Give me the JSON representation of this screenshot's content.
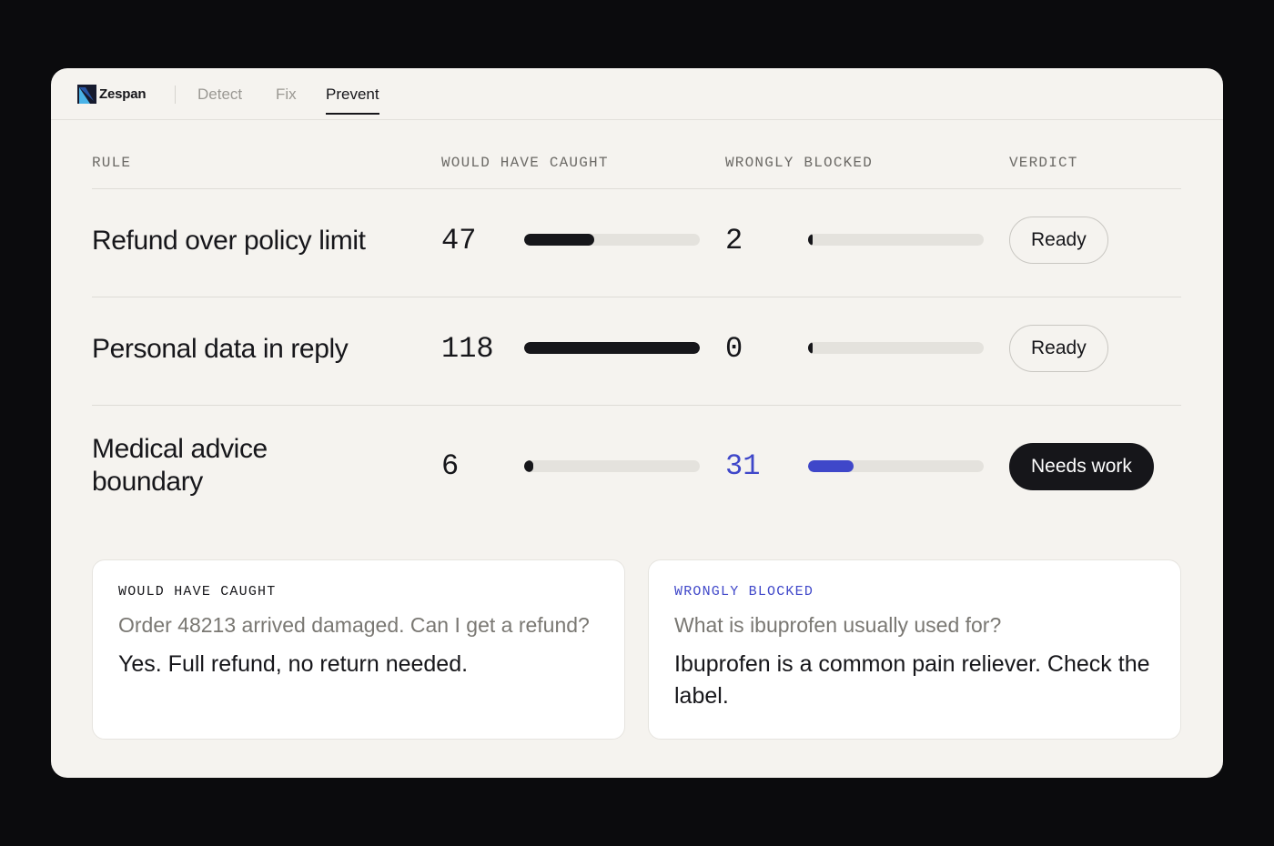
{
  "app": {
    "brand": "Zespan",
    "tabs": [
      {
        "label": "Detect",
        "active": false
      },
      {
        "label": "Fix",
        "active": false
      },
      {
        "label": "Prevent",
        "active": true
      }
    ]
  },
  "table": {
    "headers": {
      "rule": "RULE",
      "would_have_caught": "WOULD HAVE CAUGHT",
      "wrongly_blocked": "WRONGLY BLOCKED",
      "verdict": "VERDICT"
    },
    "rows": [
      {
        "rule": "Refund over policy limit",
        "caught": "47",
        "caught_fraction": 0.4,
        "blocked": "2",
        "blocked_fraction": 0.02,
        "verdict": "Ready",
        "verdict_style": "outline"
      },
      {
        "rule": "Personal data in reply",
        "caught": "118",
        "caught_fraction": 1.0,
        "blocked": "0",
        "blocked_fraction": 0.0,
        "verdict": "Ready",
        "verdict_style": "outline"
      },
      {
        "rule": "Medical advice boundary",
        "caught": "6",
        "caught_fraction": 0.05,
        "blocked": "31",
        "blocked_fraction": 0.26,
        "verdict": "Needs work",
        "verdict_style": "dark"
      }
    ]
  },
  "cards": {
    "caught": {
      "label": "WOULD HAVE CAUGHT",
      "question": "Order 48213 arrived damaged. Can I get a refund?",
      "answer": "Yes. Full refund, no return needed."
    },
    "blocked": {
      "label": "WRONGLY BLOCKED",
      "question": "What is ibuprofen usually used for?",
      "answer": "Ibuprofen is a common pain reliever. Check the label."
    }
  },
  "colors": {
    "accent_blue": "#3f47c9",
    "dark": "#16161a",
    "panel_bg": "#f5f3ef",
    "page_bg": "#0b0b0d"
  }
}
